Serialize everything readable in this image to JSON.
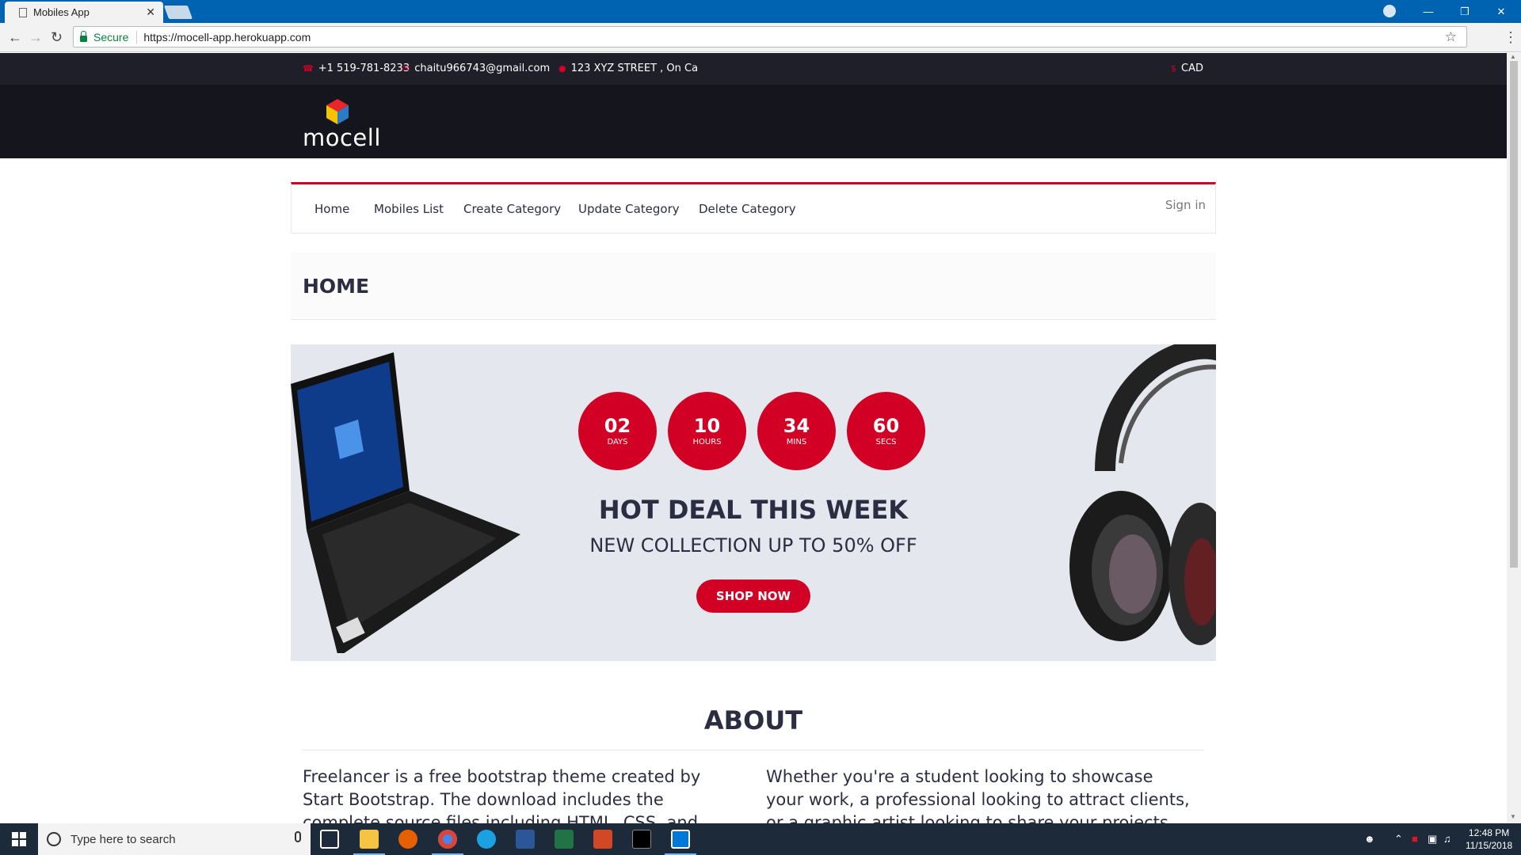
{
  "browser": {
    "tab_title": "Mobiles App",
    "tab_close": "✕",
    "secure_label": "Secure",
    "url": "https://mocell-app.herokuapp.com"
  },
  "infobar": {
    "phone": "+1 519-781-8233",
    "email": "chaitu966743@gmail.com",
    "address": "123 XYZ STREET , On Ca",
    "currency": "CAD"
  },
  "logo": {
    "text": "mocell"
  },
  "nav": {
    "items": [
      "Home",
      "Mobiles List",
      "Create Category",
      "Update Category",
      "Delete Category"
    ],
    "signin": "Sign in"
  },
  "page": {
    "heading": "HOME"
  },
  "deal": {
    "countdown": [
      {
        "value": "02",
        "unit": "DAYS"
      },
      {
        "value": "10",
        "unit": "HOURS"
      },
      {
        "value": "34",
        "unit": "MINS"
      },
      {
        "value": "60",
        "unit": "SECS"
      }
    ],
    "title": "HOT DEAL THIS WEEK",
    "subtitle": "NEW COLLECTION UP TO 50% OFF",
    "button": "SHOP NOW"
  },
  "about": {
    "title": "ABOUT",
    "left": "Freelancer is a free bootstrap theme created by Start Bootstrap. The download includes the complete source files including HTML, CSS, and",
    "right": "Whether you're a student looking to showcase your work, a professional looking to attract clients, or a graphic artist looking to share your projects, this"
  },
  "taskbar": {
    "search_placeholder": "Type here to search",
    "time": "12:48 PM",
    "date": "11/15/2018"
  },
  "colors": {
    "accent": "#d10024",
    "dark": "#15161d",
    "titlebar": "#0063b1"
  }
}
